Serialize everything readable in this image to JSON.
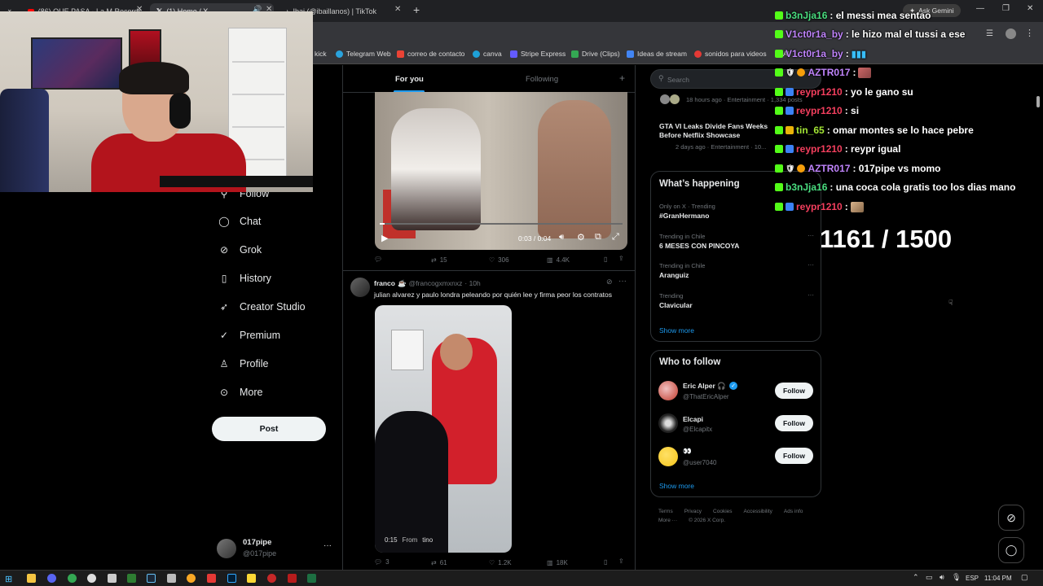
{
  "browser": {
    "tabs": [
      {
        "label": "(86) QUE PASA - La M Records",
        "icon_color": "#ff0000"
      },
      {
        "label": "(1) Home / X",
        "icon_color": "#ffffff"
      },
      {
        "label": "Ibai (@ibaillanos) | TikTok",
        "icon_color": "#ffffff"
      }
    ],
    "new_tab_symbol": "+",
    "gemini_label": "Ask Gemini",
    "bookmarks": [
      {
        "label": "kick",
        "color": "#53fc18"
      },
      {
        "label": "Telegram Web",
        "color": "#2aa3dd"
      },
      {
        "label": "correo de contacto",
        "color": "#ea4335"
      },
      {
        "label": "canva",
        "color": "#1ea1d8"
      },
      {
        "label": "Stripe Express",
        "color": "#635bff"
      },
      {
        "label": "Drive (Clips)",
        "color": "#34a853"
      },
      {
        "label": "Ideas de stream",
        "color": "#4285f4"
      },
      {
        "label": "sonidos para videos",
        "color": "#e53935"
      },
      {
        "label": "Al",
        "color": "#888888"
      }
    ]
  },
  "x_nav": {
    "items": [
      {
        "label": "Follow",
        "icon": "follow-icon"
      },
      {
        "label": "Chat",
        "icon": "chat-bubble-icon"
      },
      {
        "label": "Grok",
        "icon": "grok-icon"
      },
      {
        "label": "History",
        "icon": "bookmark-icon"
      },
      {
        "label": "Creator Studio",
        "icon": "rocket-icon"
      },
      {
        "label": "Premium",
        "icon": "verified-icon"
      },
      {
        "label": "Profile",
        "icon": "person-icon"
      },
      {
        "label": "More",
        "icon": "more-circle-icon"
      }
    ],
    "post_label": "Post",
    "account": {
      "name": "017pipe",
      "handle": "@017pipe",
      "more": "···"
    }
  },
  "feed": {
    "tabs": [
      "For you",
      "Following"
    ],
    "add_symbol": "+",
    "video1": {
      "time": "0:03 / 0:04",
      "progress": 0.02
    },
    "post1_actions": {
      "replies": "",
      "reposts": "15",
      "likes": "306",
      "views": "4.4K"
    },
    "post2": {
      "name": "franco",
      "emoji": "☕",
      "handle": "@francogxmxnxz",
      "time": "· 10h",
      "text": "julian alvarez y paulo londra peleando por quién lee y firma peor los contratos",
      "video_time": "0:15",
      "from_label": "From",
      "from_user": "tino",
      "actions": {
        "replies": "3",
        "reposts": "61",
        "likes": "1.2K",
        "views": "18K"
      }
    }
  },
  "sidebar": {
    "search_placeholder": "Search",
    "top_story_meta": "18 hours ago · Entertainment · 1,334 posts",
    "story": {
      "title": "GTA VI Leaks Divide Fans Weeks Before Netflix Showcase",
      "meta": "2 days ago · Entertainment · 10..."
    },
    "happening_title": "What’s happening",
    "trends": [
      {
        "context": "Only on X · Trending",
        "name": "#GranHermano",
        "more": ""
      },
      {
        "context": "Trending in Chile",
        "name": "6 MESES CON PINCOYA",
        "more": "···"
      },
      {
        "context": "Trending in Chile",
        "name": "Aranguiz",
        "more": "···"
      },
      {
        "context": "Trending",
        "name": "Clavicular",
        "more": "···"
      }
    ],
    "show_more": "Show more",
    "who_to_follow_title": "Who to follow",
    "follow_suggestions": [
      {
        "name": "Eric Alper 🎧",
        "handle": "@ThatEricAlper",
        "button": "Follow",
        "avatar_color": "#c0392b"
      },
      {
        "name": "Elcapi",
        "handle": "@Elcapitx",
        "button": "Follow",
        "avatar_color": "#222222"
      },
      {
        "name": "👀",
        "handle": "@user7040",
        "button": "Follow",
        "avatar_color": "#f5c518"
      }
    ],
    "show_more_2": "Show more",
    "footer_links": [
      "Terms",
      "Privacy",
      "Cookies",
      "Accessibility",
      "Ads info",
      "More ···",
      "© 2026 X Corp."
    ]
  },
  "chat": {
    "messages": [
      {
        "user": "b3nJja16",
        "text": ": el messi mea sentao",
        "color": "#4ade80",
        "emote": false
      },
      {
        "user": "V1ct0r1a_by",
        "text": ": le hizo mal el tussi a ese",
        "color": "#c084fc",
        "emote": false
      },
      {
        "user": "V1ct0r1a_by",
        "text": ":",
        "color": "#c084fc",
        "emote": true
      },
      {
        "user": "AZTR017",
        "text": ":",
        "color": "#c084fc",
        "emote": true
      },
      {
        "user": "reypr1210",
        "text": ": yo le gano su",
        "color": "#f43f5e",
        "emote": false
      },
      {
        "user": "reypr1210",
        "text": ": si",
        "color": "#f43f5e",
        "emote": false
      },
      {
        "user": "tin_65",
        "text": ": omar montes se lo hace pebre",
        "color": "#a3e635",
        "emote": false
      },
      {
        "user": "reypr1210",
        "text": ": reypr igual",
        "color": "#f43f5e",
        "emote": false
      },
      {
        "user": "AZTR017",
        "text": ": 017pipe vs momo",
        "color": "#c084fc",
        "emote": false
      },
      {
        "user": "b3nJja16",
        "text": ": una coca cola gratis too los dias mano",
        "color": "#4ade80",
        "emote": false
      },
      {
        "user": "reypr1210",
        "text": ":",
        "color": "#f43f5e",
        "emote": true
      }
    ],
    "counter": "1161 / 1500"
  },
  "taskbar": {
    "language": "ESP",
    "clock": "11:04 PM"
  }
}
